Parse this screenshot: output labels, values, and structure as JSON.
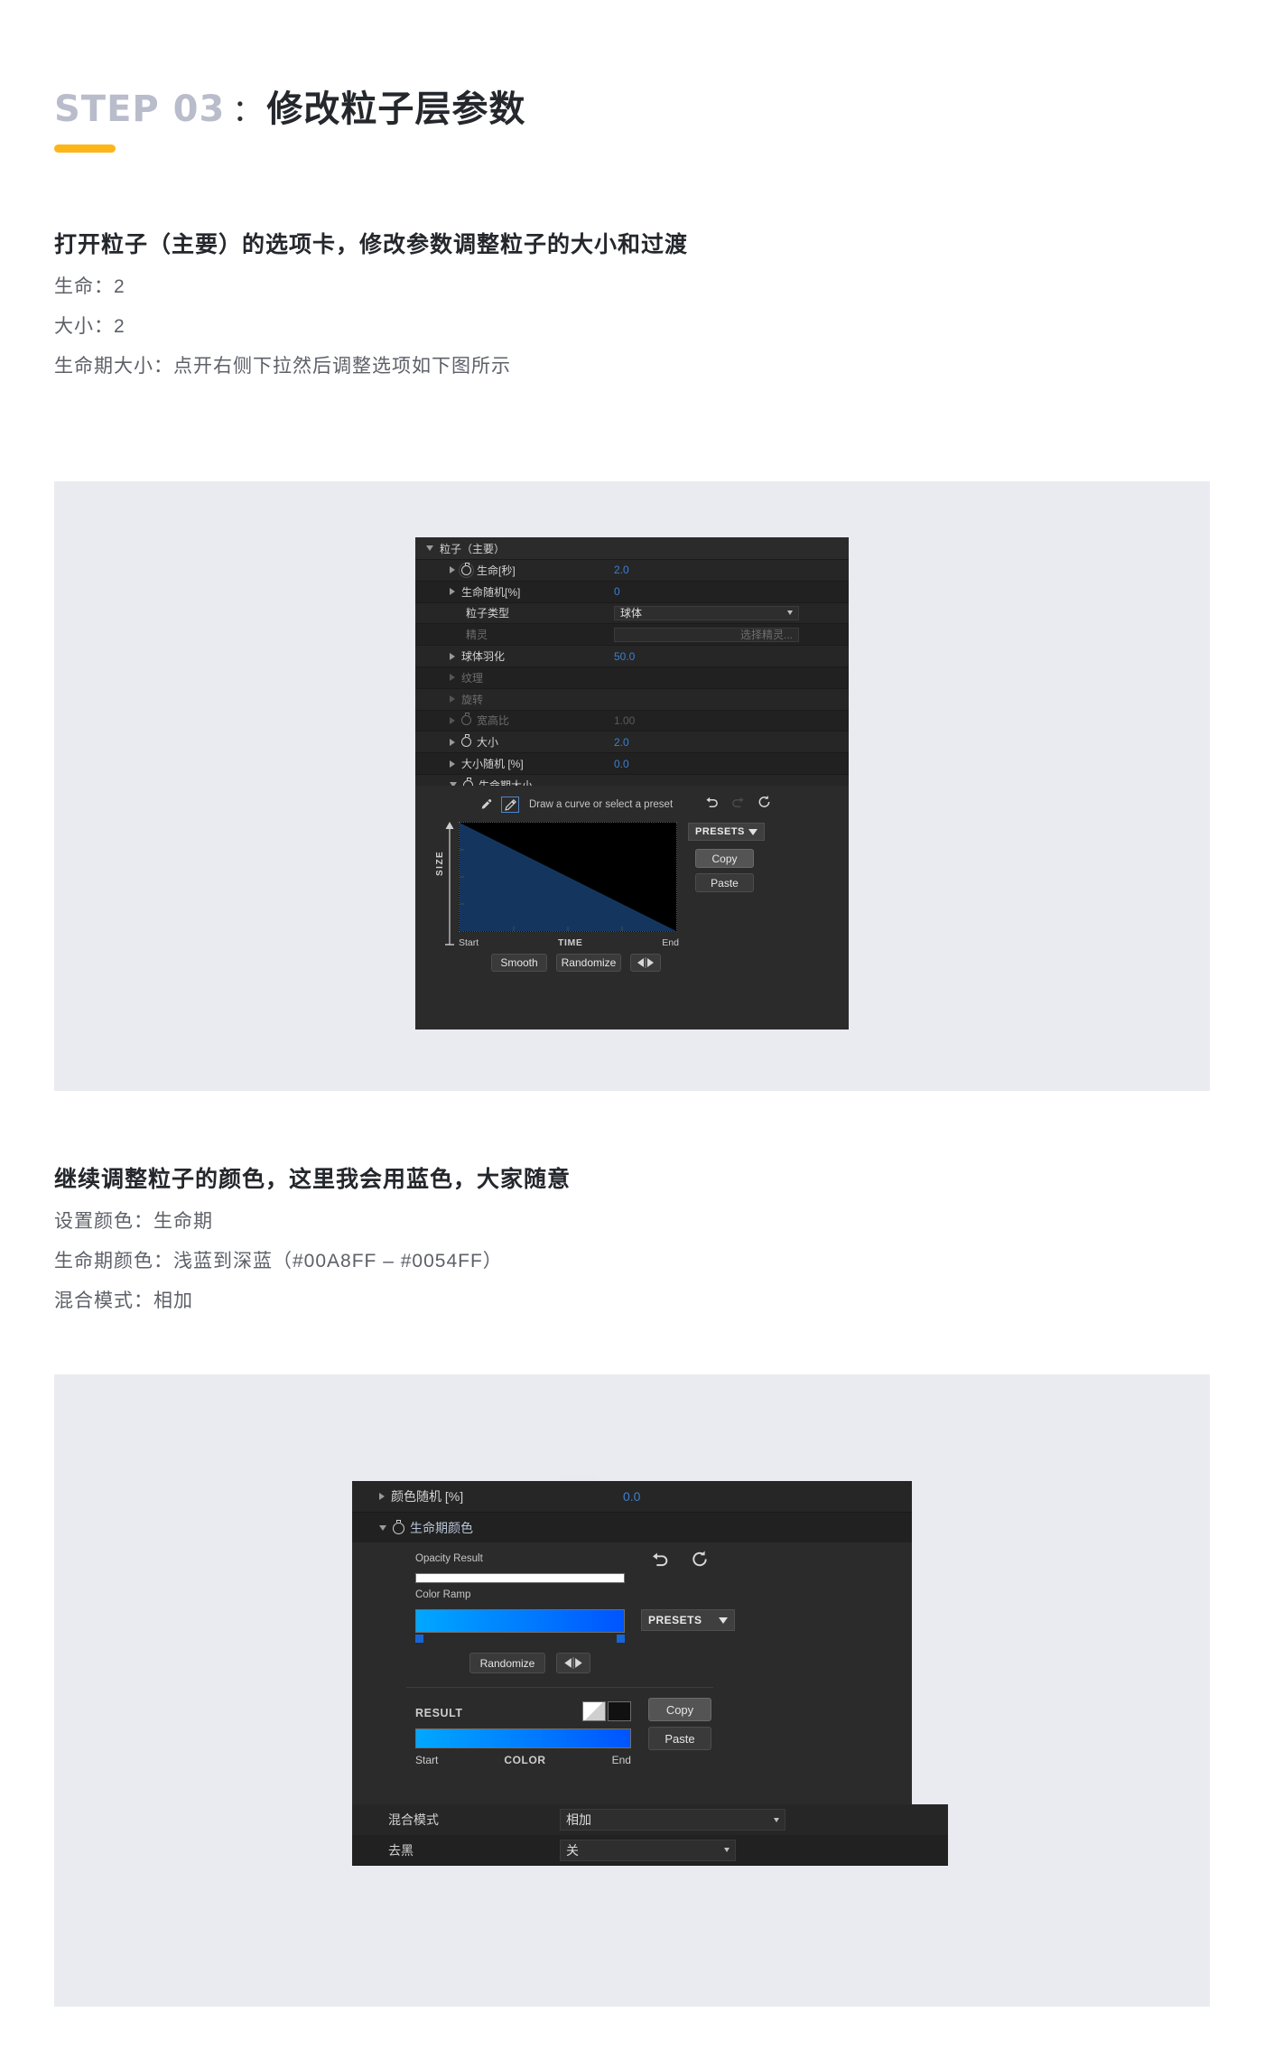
{
  "header": {
    "step_label": "STEP 03",
    "colon": "：",
    "title_zh": "修改粒子层参数"
  },
  "section1": {
    "heading": "打开粒子（主要）的选项卡，修改参数调整粒子的大小和过渡",
    "lines": [
      "生命：2",
      "大小：2",
      "生命期大小：点开右侧下拉然后调整选项如下图所示"
    ]
  },
  "section2": {
    "heading": "继续调整粒子的颜色，这里我会用蓝色，大家随意",
    "lines": [
      "设置颜色：生命期",
      "生命期颜色：浅蓝到深蓝（#00A8FF – #0054FF）",
      "混合模式：相加"
    ]
  },
  "panel1": {
    "group_title": "粒子（主要）",
    "rows": [
      {
        "name": "生命[秒]",
        "value": "2.0",
        "arrow": "right",
        "stopwatch": true,
        "dim": false,
        "kind": "num"
      },
      {
        "name": "生命随机[%]",
        "value": "0",
        "arrow": "right",
        "stopwatch": false,
        "dim": false,
        "kind": "num"
      },
      {
        "name": "粒子类型",
        "value": "球体",
        "arrow": "none",
        "stopwatch": false,
        "dim": false,
        "kind": "dropdown"
      },
      {
        "name": "精灵",
        "value": "选择精灵...",
        "arrow": "none",
        "stopwatch": false,
        "dim": true,
        "kind": "placeholder"
      },
      {
        "name": "球体羽化",
        "value": "50.0",
        "arrow": "right",
        "stopwatch": false,
        "dim": false,
        "kind": "num"
      },
      {
        "name": "纹理",
        "value": "",
        "arrow": "right",
        "stopwatch": false,
        "dim": true,
        "kind": "num"
      },
      {
        "name": "旋转",
        "value": "",
        "arrow": "right",
        "stopwatch": false,
        "dim": true,
        "kind": "num"
      },
      {
        "name": "宽高比",
        "value": "1.00",
        "arrow": "right",
        "stopwatch": true,
        "dim": true,
        "kind": "num"
      },
      {
        "name": "大小",
        "value": "2.0",
        "arrow": "right",
        "stopwatch": true,
        "dim": false,
        "kind": "num"
      },
      {
        "name": "大小随机 [%]",
        "value": "0.0",
        "arrow": "right",
        "stopwatch": false,
        "dim": false,
        "kind": "num"
      },
      {
        "name": "生命期大小",
        "value": "",
        "arrow": "down",
        "stopwatch": true,
        "dim": false,
        "kind": "num"
      }
    ],
    "curve_editor": {
      "hint": "Draw a curve or select a preset",
      "y_axis_label": "SIZE",
      "x_axis_label": "TIME",
      "x_start": "Start",
      "x_end": "End",
      "presets_label": "PRESETS",
      "copy_label": "Copy",
      "paste_label": "Paste",
      "smooth_label": "Smooth",
      "randomize_label": "Randomize",
      "curve_fill_color": "#14365e",
      "curve_type": "linear-descending"
    }
  },
  "panel2": {
    "rows_top": [
      {
        "name": "颜色随机 [%]",
        "value": "0.0",
        "arrow": "right",
        "stopwatch": false
      },
      {
        "name": "生命期颜色",
        "value": "",
        "arrow": "down",
        "stopwatch": true
      }
    ],
    "color_editor": {
      "opacity_label": "Opacity Result",
      "opacity_color": "#ffffff",
      "ramp_label": "Color Ramp",
      "ramp_from": "#00A8FF",
      "ramp_to": "#0054FF",
      "presets_label": "PRESETS",
      "randomize_label": "Randomize",
      "result_label": "RESULT",
      "copy_label": "Copy",
      "paste_label": "Paste",
      "x_start": "Start",
      "x_axis_label": "COLOR",
      "x_end": "End"
    },
    "rows_bottom": [
      {
        "name": "混合模式",
        "value": "相加"
      },
      {
        "name": "去黑",
        "value": "关"
      }
    ]
  },
  "colors": {
    "accent_bar": "#fcb61a",
    "step_gray": "#b9bcca",
    "band_bg": "#eaebf0",
    "panel_bg": "#262626"
  }
}
